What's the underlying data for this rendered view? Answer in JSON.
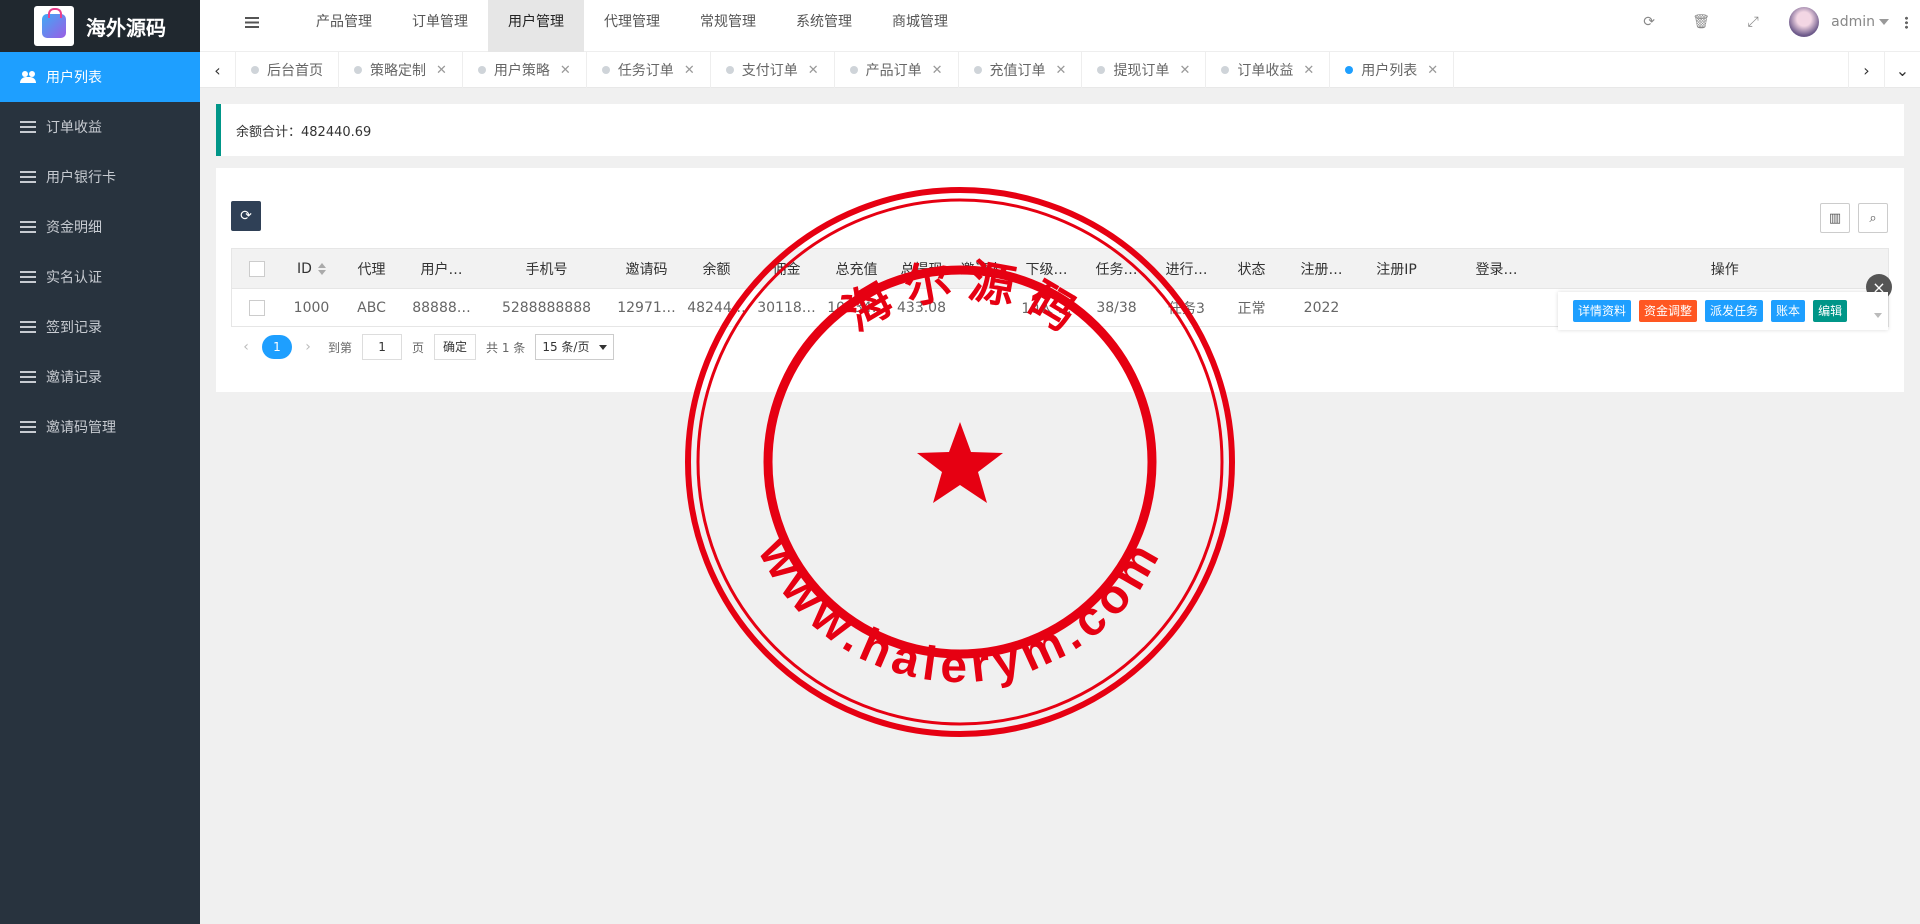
{
  "brand": {
    "name": "海外源码"
  },
  "sidebar": {
    "items": [
      {
        "label": "用户列表",
        "icon": "users-icon"
      },
      {
        "label": "订单收益",
        "icon": "list-icon"
      },
      {
        "label": "用户银行卡",
        "icon": "list-icon"
      },
      {
        "label": "资金明细",
        "icon": "list-icon"
      },
      {
        "label": "实名认证",
        "icon": "list-icon"
      },
      {
        "label": "签到记录",
        "icon": "list-icon"
      },
      {
        "label": "邀请记录",
        "icon": "list-icon"
      },
      {
        "label": "邀请码管理",
        "icon": "list-icon"
      }
    ]
  },
  "topnav": {
    "items": [
      "产品管理",
      "订单管理",
      "用户管理",
      "代理管理",
      "常规管理",
      "系统管理",
      "商城管理"
    ],
    "active": "用户管理"
  },
  "header": {
    "user": "admin"
  },
  "tabs": {
    "items": [
      {
        "label": "后台首页",
        "closable": false
      },
      {
        "label": "策略定制",
        "closable": true
      },
      {
        "label": "用户策略",
        "closable": true
      },
      {
        "label": "任务订单",
        "closable": true
      },
      {
        "label": "支付订单",
        "closable": true
      },
      {
        "label": "产品订单",
        "closable": true
      },
      {
        "label": "充值订单",
        "closable": true
      },
      {
        "label": "提现订单",
        "closable": true
      },
      {
        "label": "订单收益",
        "closable": true
      },
      {
        "label": "用户列表",
        "closable": true
      }
    ],
    "active": "用户列表"
  },
  "summary": {
    "text": "余额合计：482440.69"
  },
  "table": {
    "columns": [
      "ID",
      "代理",
      "用户…",
      "手机号",
      "邀请码",
      "余额",
      "佣金",
      "总充值",
      "总提现",
      "邀请人",
      "下级…",
      "任务…",
      "进行…",
      "状态",
      "注册…",
      "注册IP",
      "登录…",
      "操作"
    ],
    "rows": [
      [
        "1000",
        "ABC",
        "88888…",
        "5288888888",
        "12971…",
        "48244…",
        "30118…",
        "10034…",
        "433.08",
        "",
        "10人 …",
        "38/38",
        "任务3",
        "正常",
        "2022",
        "",
        "",
        ""
      ]
    ]
  },
  "row_actions": [
    {
      "label": "详情资料",
      "color": "#1e9fff"
    },
    {
      "label": "资金调整",
      "color": "#ff5722"
    },
    {
      "label": "派发任务",
      "color": "#1e9fff"
    },
    {
      "label": "账本",
      "color": "#1e9fff"
    },
    {
      "label": "编辑",
      "color": "#009688"
    }
  ],
  "pager": {
    "current": "1",
    "goto_label": "到第",
    "page_input": "1",
    "page_unit": "页",
    "confirm": "确定",
    "total": "共 1 条",
    "per_page": "15 条/页"
  },
  "watermark": {
    "title": "海 尔 源 码",
    "url": "www.haierym.com",
    "color": "#e60012"
  }
}
